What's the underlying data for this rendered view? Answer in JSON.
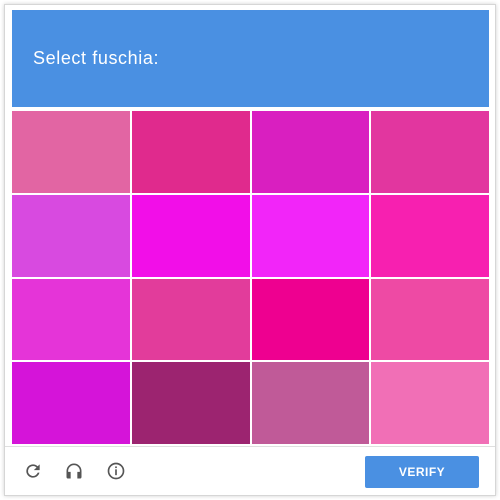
{
  "header": {
    "prompt": "Select fuschia:",
    "background_color": "#4a90e2"
  },
  "grid": {
    "tiles": [
      {
        "color": "#e265a3"
      },
      {
        "color": "#e02a8d"
      },
      {
        "color": "#d91fc0"
      },
      {
        "color": "#e2369f"
      },
      {
        "color": "#d84ae0"
      },
      {
        "color": "#f20ee8"
      },
      {
        "color": "#f225f9"
      },
      {
        "color": "#f720b0"
      },
      {
        "color": "#e534d8"
      },
      {
        "color": "#e23c9b"
      },
      {
        "color": "#ee0090"
      },
      {
        "color": "#ee4aa4"
      },
      {
        "color": "#d514d9"
      },
      {
        "color": "#9c2470"
      },
      {
        "color": "#c05a98"
      },
      {
        "color": "#f16fb6"
      }
    ]
  },
  "footer": {
    "icons": [
      "reload-icon",
      "audio-icon",
      "info-icon"
    ],
    "verify_label": "VERIFY",
    "accent_color": "#4a90e2"
  }
}
